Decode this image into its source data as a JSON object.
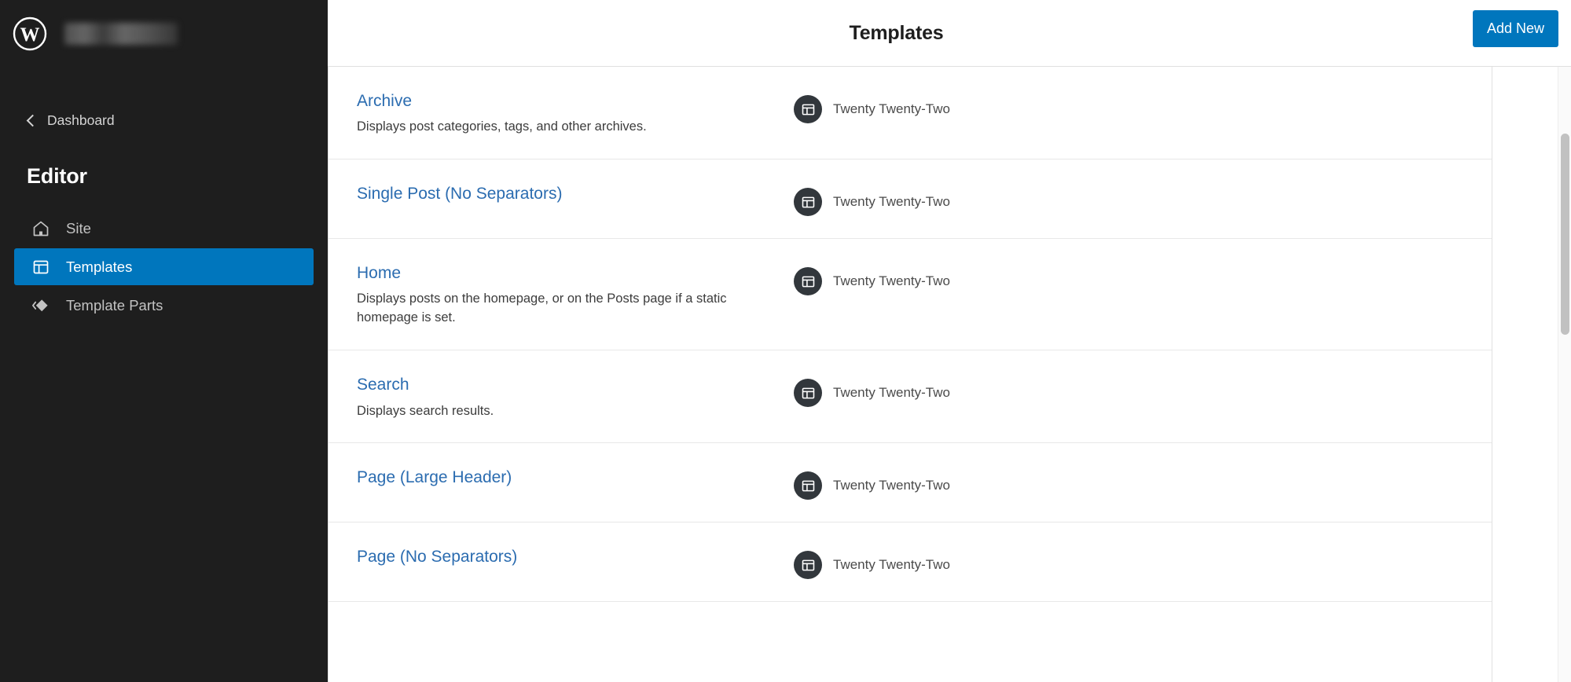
{
  "sidebar": {
    "logo_icon": "wordpress-logo-icon",
    "site_name_redacted": "",
    "dashboard_label": "Dashboard",
    "editor_heading": "Editor",
    "items": [
      {
        "label": "Site",
        "icon": "home-icon",
        "active": false
      },
      {
        "label": "Templates",
        "icon": "template-layout-icon",
        "active": true
      },
      {
        "label": "Template Parts",
        "icon": "template-parts-icon",
        "active": false
      }
    ]
  },
  "header": {
    "title": "Templates",
    "add_new_label": "Add New"
  },
  "templates": {
    "theme_name": "Twenty Twenty-Two",
    "rows": [
      {
        "title": "Archive",
        "description": "Displays post categories, tags, and other archives.",
        "theme": "Twenty Twenty-Two"
      },
      {
        "title": "Single Post (No Separators)",
        "description": "",
        "theme": "Twenty Twenty-Two"
      },
      {
        "title": "Home",
        "description": "Displays posts on the homepage, or on the Posts page if a static homepage is set.",
        "theme": "Twenty Twenty-Two"
      },
      {
        "title": "Search",
        "description": "Displays search results.",
        "theme": "Twenty Twenty-Two"
      },
      {
        "title": "Page (Large Header)",
        "description": "",
        "theme": "Twenty Twenty-Two"
      },
      {
        "title": "Page (No Separators)",
        "description": "",
        "theme": "Twenty Twenty-Two"
      }
    ]
  },
  "colors": {
    "accent_blue": "#0076bd",
    "link_blue": "#2b6cb0",
    "sidebar_bg": "#1e1e1e",
    "badge_bg": "#32373c"
  }
}
